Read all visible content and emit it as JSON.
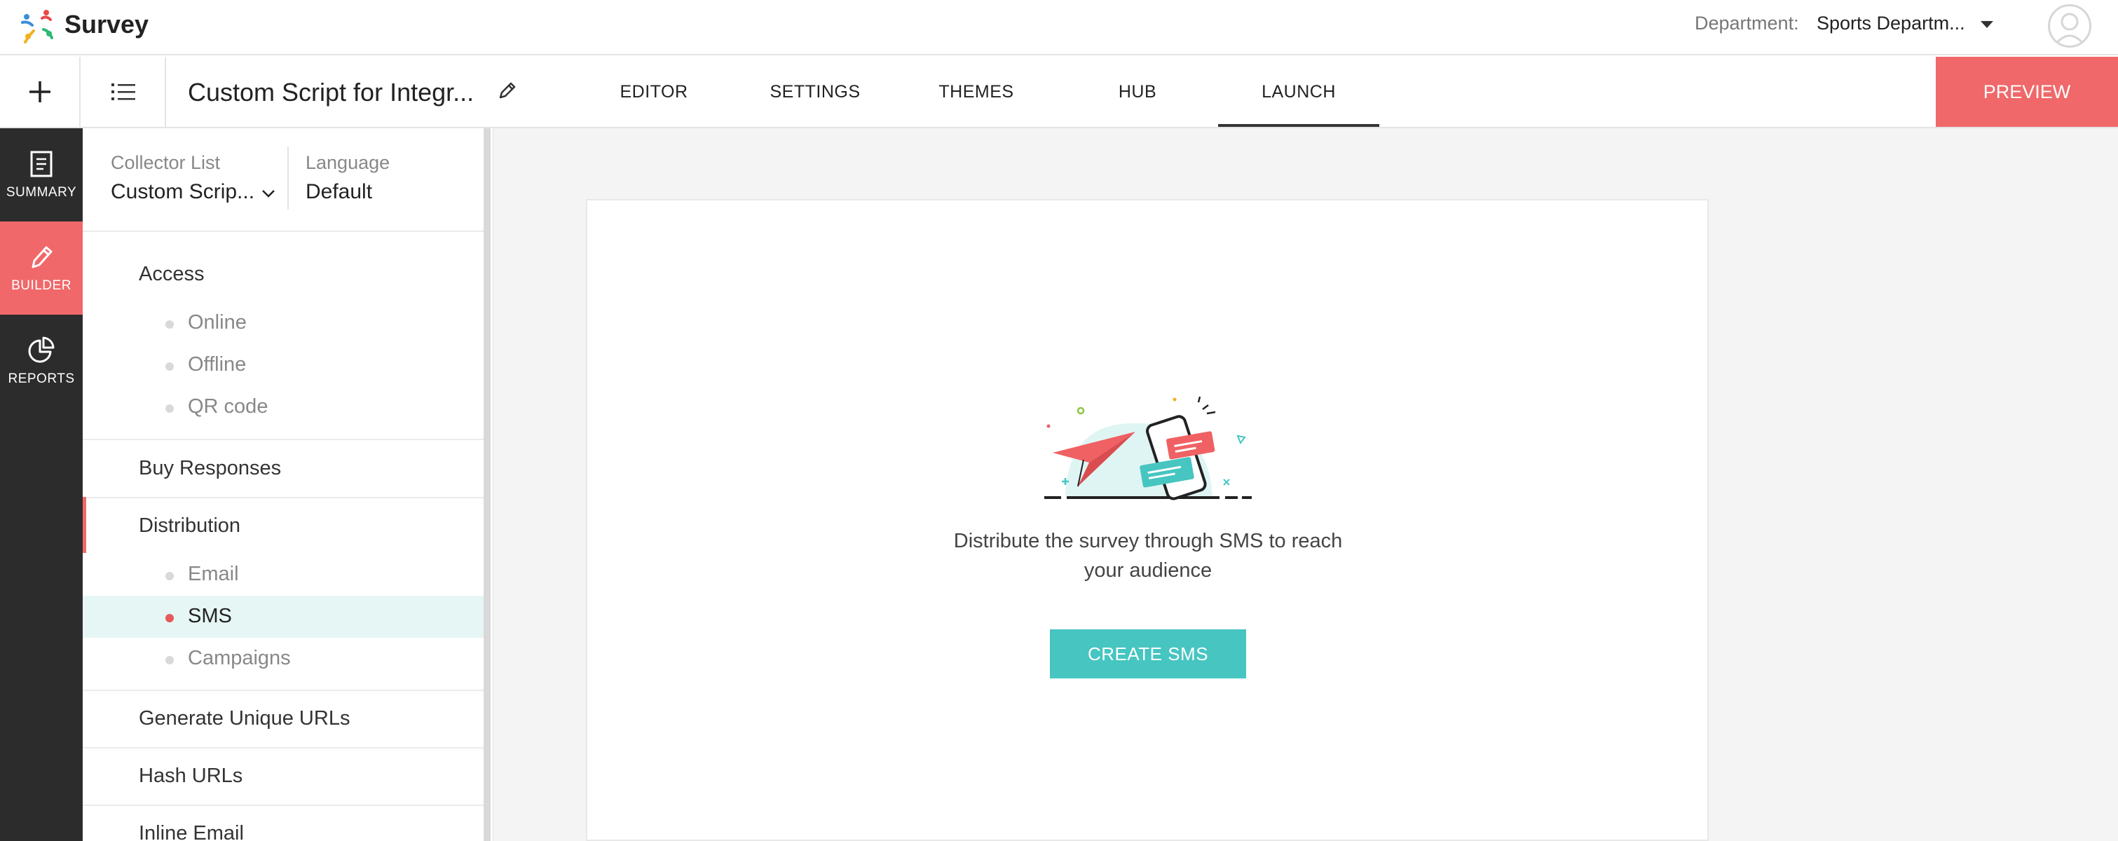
{
  "app": {
    "name": "Survey"
  },
  "header": {
    "department_label": "Department:",
    "department_value": "Sports Departm..."
  },
  "toolbar": {
    "survey_title": "Custom Script for Integr...",
    "tabs": [
      {
        "label": "EDITOR",
        "active": false
      },
      {
        "label": "SETTINGS",
        "active": false
      },
      {
        "label": "THEMES",
        "active": false
      },
      {
        "label": "HUB",
        "active": false
      },
      {
        "label": "LAUNCH",
        "active": true
      }
    ],
    "preview_label": "PREVIEW"
  },
  "rail": {
    "items": [
      {
        "label": "SUMMARY",
        "icon": "summary-icon",
        "active": false
      },
      {
        "label": "BUILDER",
        "icon": "pencil-icon",
        "active": true
      },
      {
        "label": "REPORTS",
        "icon": "pie-chart-icon",
        "active": false
      }
    ]
  },
  "collector": {
    "list_label": "Collector List",
    "list_value": "Custom Scrip...",
    "language_label": "Language",
    "language_value": "Default"
  },
  "sections": {
    "access": {
      "title": "Access",
      "items": [
        "Online",
        "Offline",
        "QR code"
      ]
    },
    "buy_responses": "Buy Responses",
    "distribution": {
      "title": "Distribution",
      "items": [
        "Email",
        "SMS",
        "Campaigns"
      ],
      "active": "SMS"
    },
    "generate_urls": "Generate Unique URLs",
    "hash_urls": "Hash URLs",
    "inline_email": "Inline Email"
  },
  "main": {
    "message_line1": "Distribute the survey through SMS to reach",
    "message_line2": "your audience",
    "create_button": "CREATE SMS"
  },
  "colors": {
    "accent": "#f0686a",
    "teal": "#46c5c1",
    "rail": "#2c2c2c"
  }
}
